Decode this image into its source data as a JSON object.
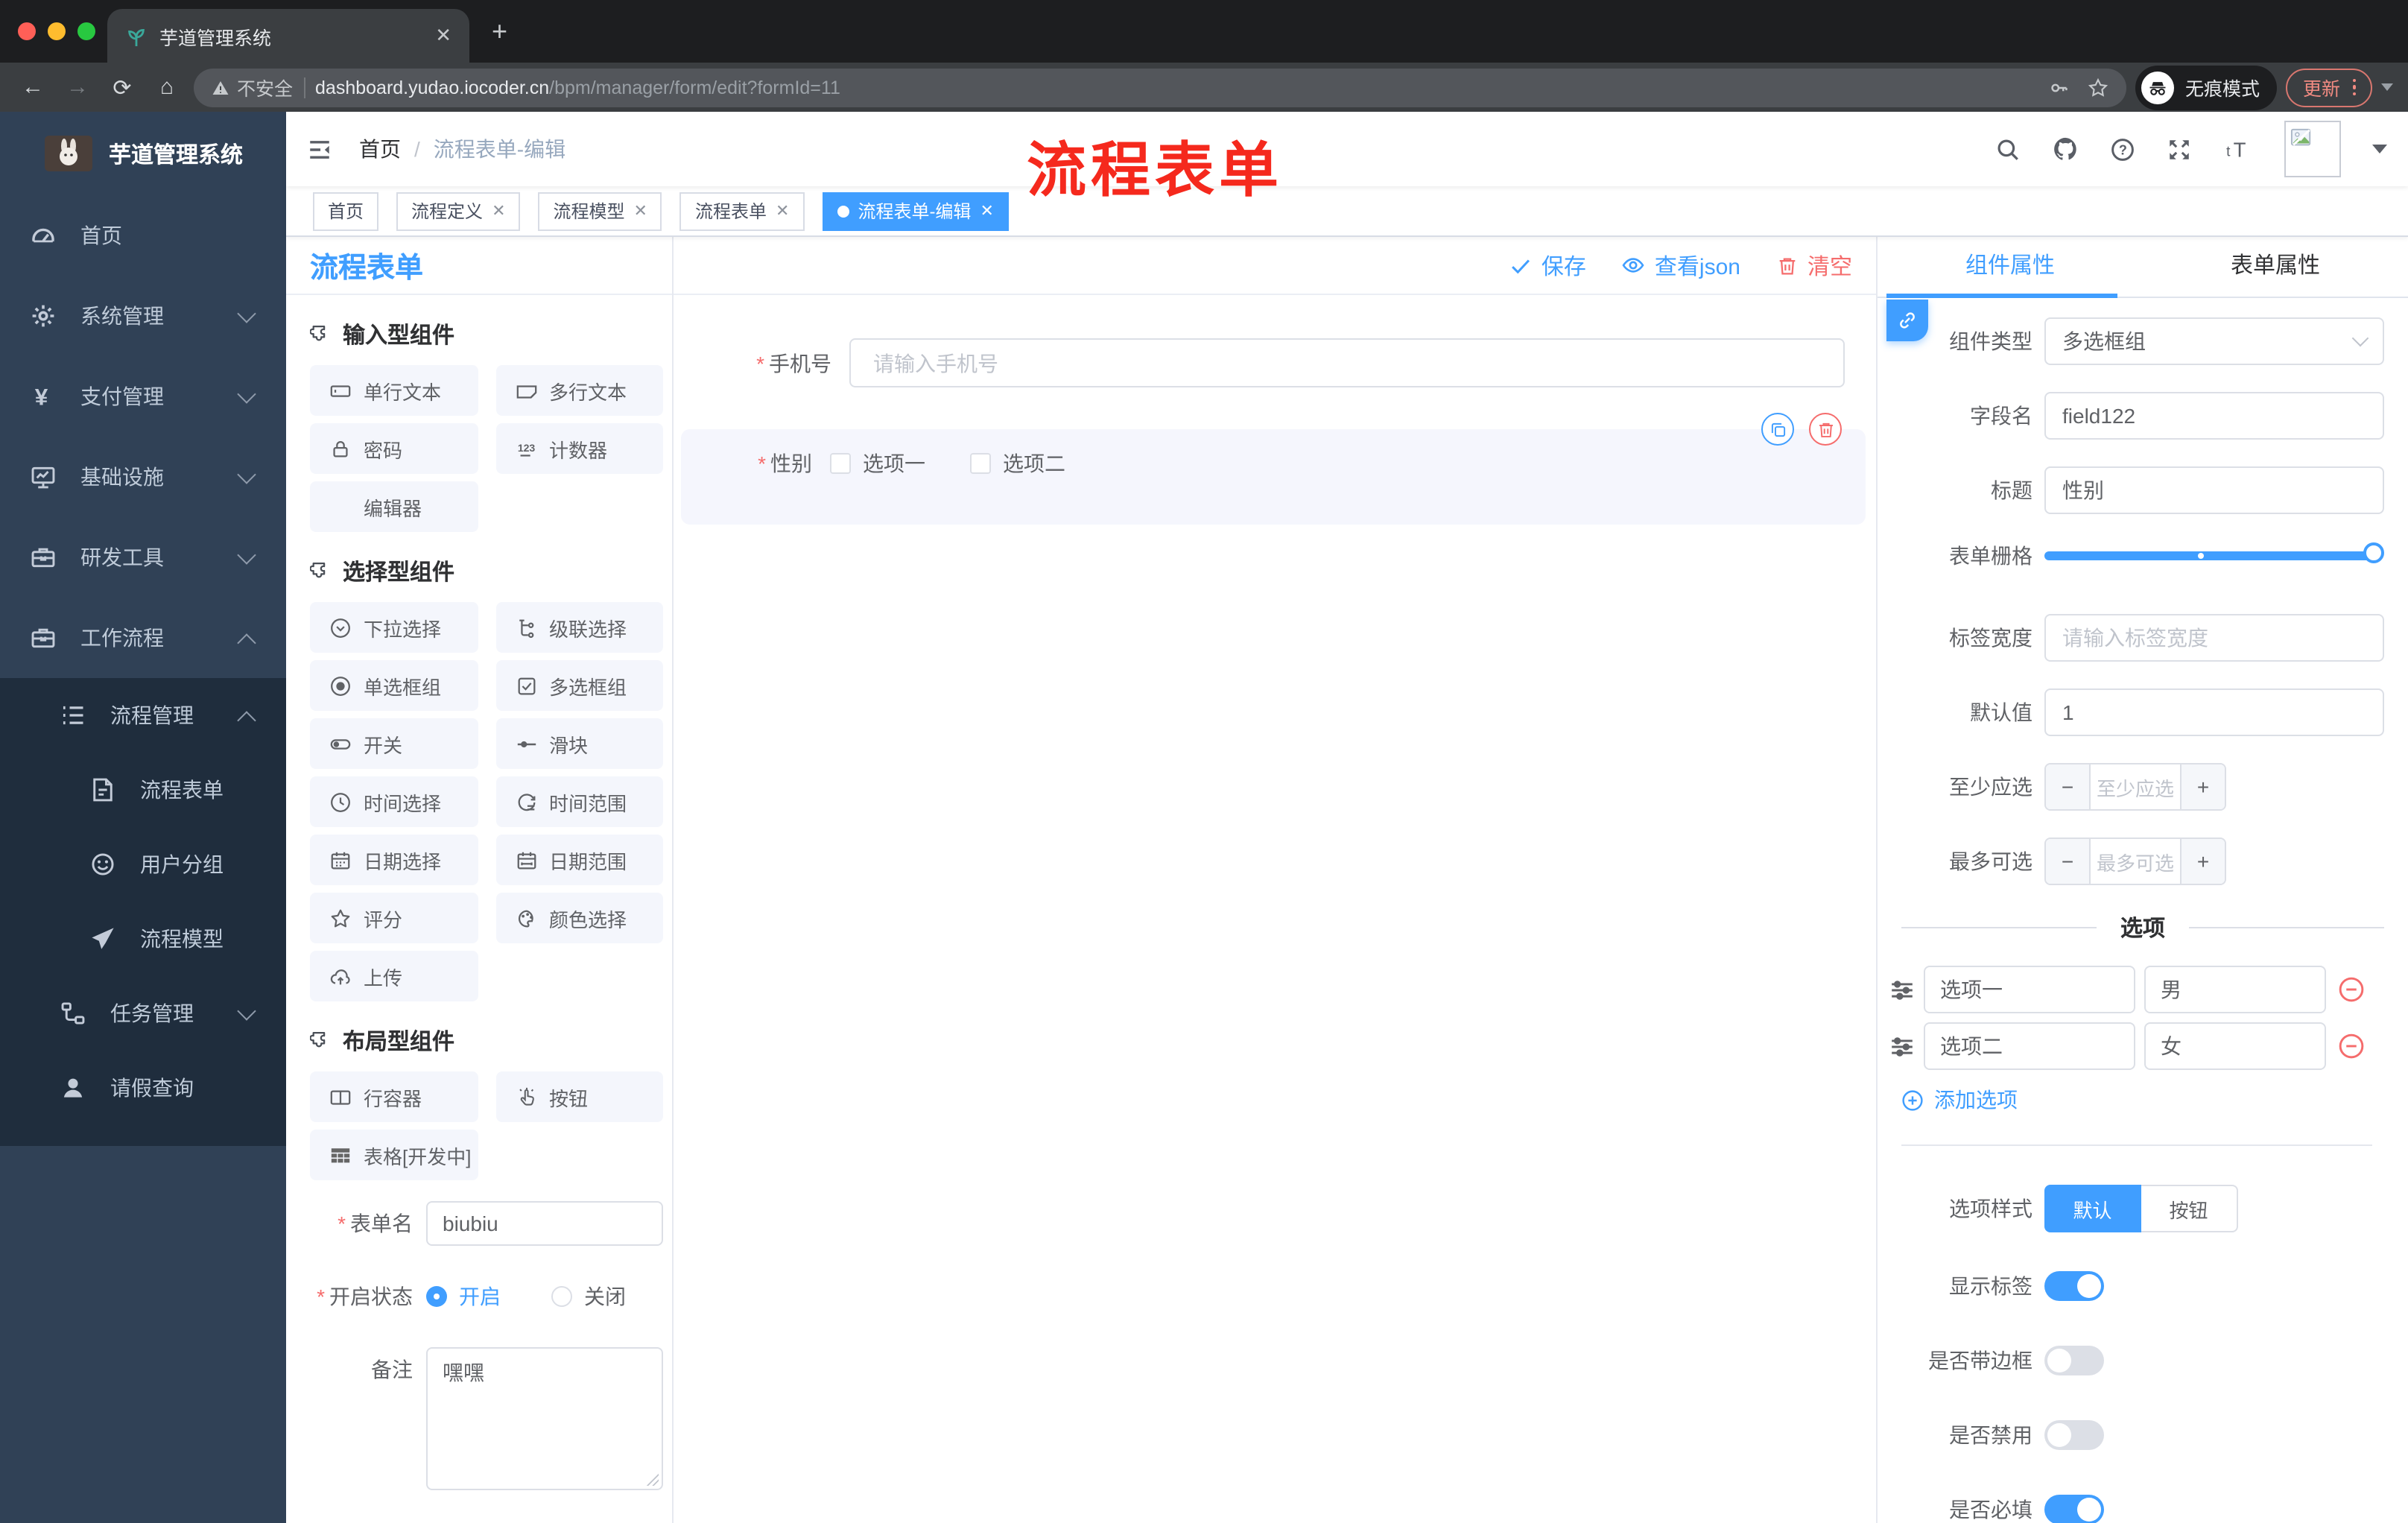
{
  "colors": {
    "accent": "#409eff",
    "danger": "#f56c6c",
    "sidebar_bg": "#304156",
    "submenu_bg": "#1f2d3d",
    "watermark_red": "#f5291d"
  },
  "browser": {
    "tab_title": "芋道管理系统",
    "security_label": "不安全",
    "url_host": "dashboard.yudao.iocoder.cn",
    "url_path": "/bpm/manager/form/edit?formId=11",
    "incognito_label": "无痕模式",
    "update_label": "更新"
  },
  "sidebar": {
    "logo_title": "芋道管理系统",
    "home": "首页",
    "system": "系统管理",
    "payment": "支付管理",
    "infra": "基础设施",
    "devtools": "研发工具",
    "workflow": "工作流程",
    "process_mgmt": "流程管理",
    "process_form": "流程表单",
    "user_group": "用户分组",
    "process_model": "流程模型",
    "task_mgmt": "任务管理",
    "leave_query": "请假查询"
  },
  "header": {
    "breadcrumb_home": "首页",
    "breadcrumb_current": "流程表单-编辑",
    "watermark": "流程表单"
  },
  "tags": {
    "t0": "首页",
    "t1": "流程定义",
    "t2": "流程模型",
    "t3": "流程表单",
    "active": "流程表单-编辑"
  },
  "panel": {
    "title": "流程表单",
    "sections": {
      "input": "输入型组件",
      "select": "选择型组件",
      "layout": "布局型组件"
    },
    "chips": {
      "single_text": "单行文本",
      "multi_text": "多行文本",
      "password": "密码",
      "counter": "计数器",
      "editor": "编辑器",
      "dropdown": "下拉选择",
      "cascader": "级联选择",
      "radio_group": "单选框组",
      "checkbox_group": "多选框组",
      "switch": "开关",
      "slider": "滑块",
      "time_picker": "时间选择",
      "time_range": "时间范围",
      "date_picker": "日期选择",
      "date_range": "日期范围",
      "rate": "评分",
      "color_picker": "颜色选择",
      "upload": "上传",
      "row_container": "行容器",
      "button": "按钮",
      "table": "表格[开发中]"
    },
    "form": {
      "name_label": "表单名",
      "name_value": "biubiu",
      "status_label": "开启状态",
      "status_on": "开启",
      "status_off": "关闭",
      "remark_label": "备注",
      "remark_value": "嘿嘿"
    }
  },
  "toolbar": {
    "save": "保存",
    "view_json": "查看json",
    "clear": "清空"
  },
  "canvas": {
    "phone_label": "手机号",
    "phone_placeholder": "请输入手机号",
    "gender_label": "性别",
    "gender_opt1": "选项一",
    "gender_opt2": "选项二"
  },
  "props": {
    "tab_component": "组件属性",
    "tab_form": "表单属性",
    "type_label": "组件类型",
    "type_value": "多选框组",
    "field_label": "字段名",
    "field_value": "field122",
    "title_label": "标题",
    "title_value": "性别",
    "grid_label": "表单栅格",
    "label_width_label": "标签宽度",
    "label_width_placeholder": "请输入标签宽度",
    "default_label": "默认值",
    "default_value": "1",
    "min_label": "至少应选",
    "min_placeholder": "至少应选",
    "max_label": "最多可选",
    "max_placeholder": "最多可选",
    "options_title": "选项",
    "options": [
      {
        "label": "选项一",
        "value": "男"
      },
      {
        "label": "选项二",
        "value": "女"
      }
    ],
    "add_option": "添加选项",
    "style_label": "选项样式",
    "style_default": "默认",
    "style_button": "按钮",
    "show_label_label": "显示标签",
    "bordered_label": "是否带边框",
    "disabled_label": "是否禁用",
    "required_label": "是否必填"
  }
}
